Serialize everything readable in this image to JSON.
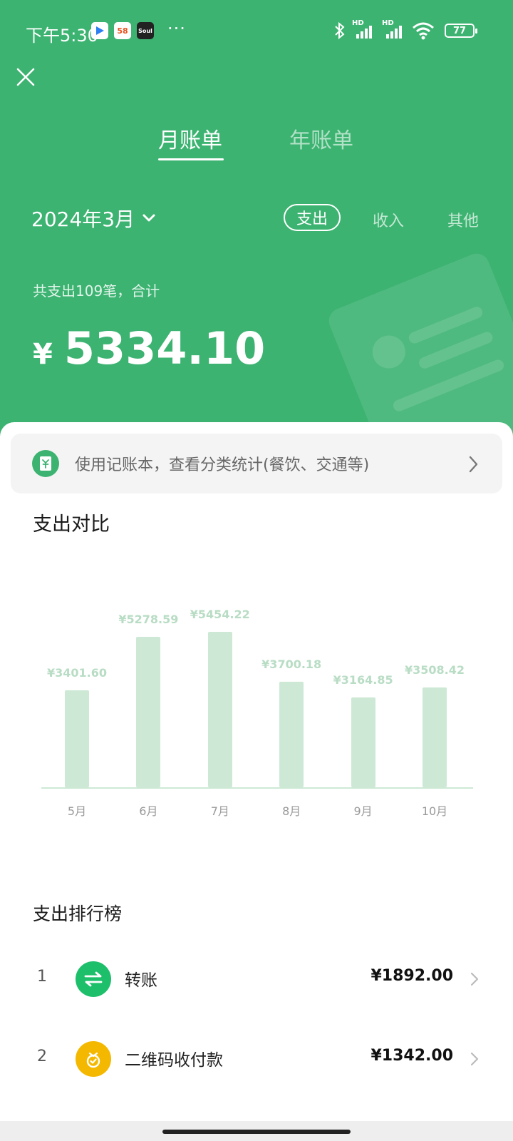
{
  "status_bar": {
    "time": "下午5:30",
    "apps": [
      "58",
      "Soul"
    ],
    "more": "···",
    "signal": "HD",
    "battery": "77"
  },
  "tabs": [
    {
      "label": "月账单",
      "active": true
    },
    {
      "label": "年账单",
      "active": false
    }
  ],
  "period": {
    "label": "2024年3月"
  },
  "filters": [
    {
      "label": "支出",
      "active": true
    },
    {
      "label": "收入",
      "active": false
    },
    {
      "label": "其他",
      "active": false
    }
  ],
  "summary": {
    "text": "共支出109笔，合计",
    "currency": "¥",
    "amount": "5334.10"
  },
  "banner": {
    "text": "使用记账本，查看分类统计(餐饮、交通等)"
  },
  "comparison_title": "支出对比",
  "chart_data": {
    "type": "bar",
    "categories": [
      "5月",
      "6月",
      "7月",
      "8月",
      "9月",
      "10月"
    ],
    "values": [
      3401.6,
      5278.59,
      5454.22,
      3700.18,
      3164.85,
      3508.42
    ],
    "value_labels": [
      "¥3401.60",
      "¥5278.59",
      "¥5454.22",
      "¥3700.18",
      "¥3164.85",
      "¥3508.42"
    ],
    "title": "",
    "xlabel": "",
    "ylabel": "",
    "grid": false,
    "ylim": [
      0,
      5454.22
    ]
  },
  "ranking": {
    "title": "支出排行榜",
    "items": [
      {
        "rank": "1",
        "name": "转账",
        "amount": "¥1892.00",
        "icon": "transfer-icon",
        "color": "#1dbf6b"
      },
      {
        "rank": "2",
        "name": "二维码收付款",
        "amount": "¥1342.00",
        "icon": "qr-payment-icon",
        "color": "#f5b800"
      }
    ]
  },
  "colors": {
    "brand_green": "#3cb371",
    "bar_fill": "#cde9d5",
    "bar_label": "#b8dcc4"
  }
}
